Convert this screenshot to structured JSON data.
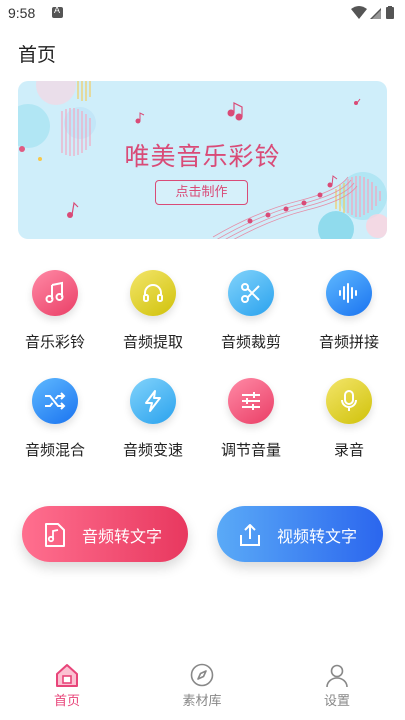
{
  "status_bar": {
    "time": "9:58"
  },
  "header": {
    "title": "首页"
  },
  "banner": {
    "title": "唯美音乐彩铃",
    "button_label": "点击制作",
    "accent": "#d94b77"
  },
  "tools": [
    {
      "label": "音乐彩铃",
      "icon": "music-note-icon"
    },
    {
      "label": "音频提取",
      "icon": "headphones-icon"
    },
    {
      "label": "音频裁剪",
      "icon": "scissors-icon"
    },
    {
      "label": "音频拼接",
      "icon": "waveform-icon"
    },
    {
      "label": "音频混合",
      "icon": "shuffle-icon"
    },
    {
      "label": "音频变速",
      "icon": "lightning-icon"
    },
    {
      "label": "调节音量",
      "icon": "sliders-icon"
    },
    {
      "label": "录音",
      "icon": "microphone-icon"
    }
  ],
  "actions": [
    {
      "label": "音频转文字",
      "icon": "audio-file-icon"
    },
    {
      "label": "视频转文字",
      "icon": "upload-icon"
    }
  ],
  "tabbar": {
    "items": [
      {
        "label": "首页",
        "icon": "home-icon",
        "active": true
      },
      {
        "label": "素材库",
        "icon": "compass-icon",
        "active": false
      },
      {
        "label": "设置",
        "icon": "person-icon",
        "active": false
      }
    ],
    "active_color": "#e8457a",
    "inactive_color": "#888888"
  }
}
